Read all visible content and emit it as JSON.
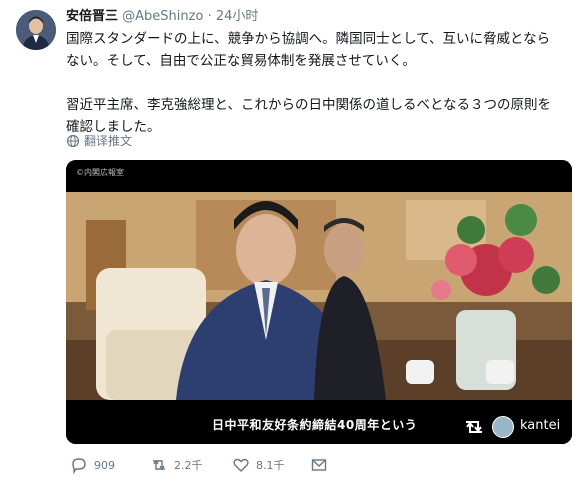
{
  "tweet": {
    "author_name": "安倍晋三",
    "handle": "@AbeShinzo",
    "separator": "·",
    "time": "24小时",
    "lines": [
      "国際スタンダードの上に、競争から協調へ。隣国同士として、互いに脅威となら",
      "ない。そして、自由で公正な貿易体制を発展させていく。",
      "習近平主席、李克強総理と、これからの日中関係の道しるべとなる３つの原則を",
      "確認しました。"
    ],
    "translate_label": "翻译推文"
  },
  "media": {
    "credit": "©内閣広報室",
    "caption": "日中平和友好条約締結40周年という",
    "brand": "kantei"
  },
  "actions": {
    "reply_count": "909",
    "retweet_count": "2.2千",
    "like_count": "8.1千"
  },
  "colors": {
    "text_primary": "#14171a",
    "text_secondary": "#657786",
    "background": "#ffffff"
  },
  "icons": [
    "avatar",
    "globe-icon",
    "retweet-icon",
    "kantei-logo-icon",
    "reply-icon",
    "like-icon",
    "message-icon"
  ]
}
